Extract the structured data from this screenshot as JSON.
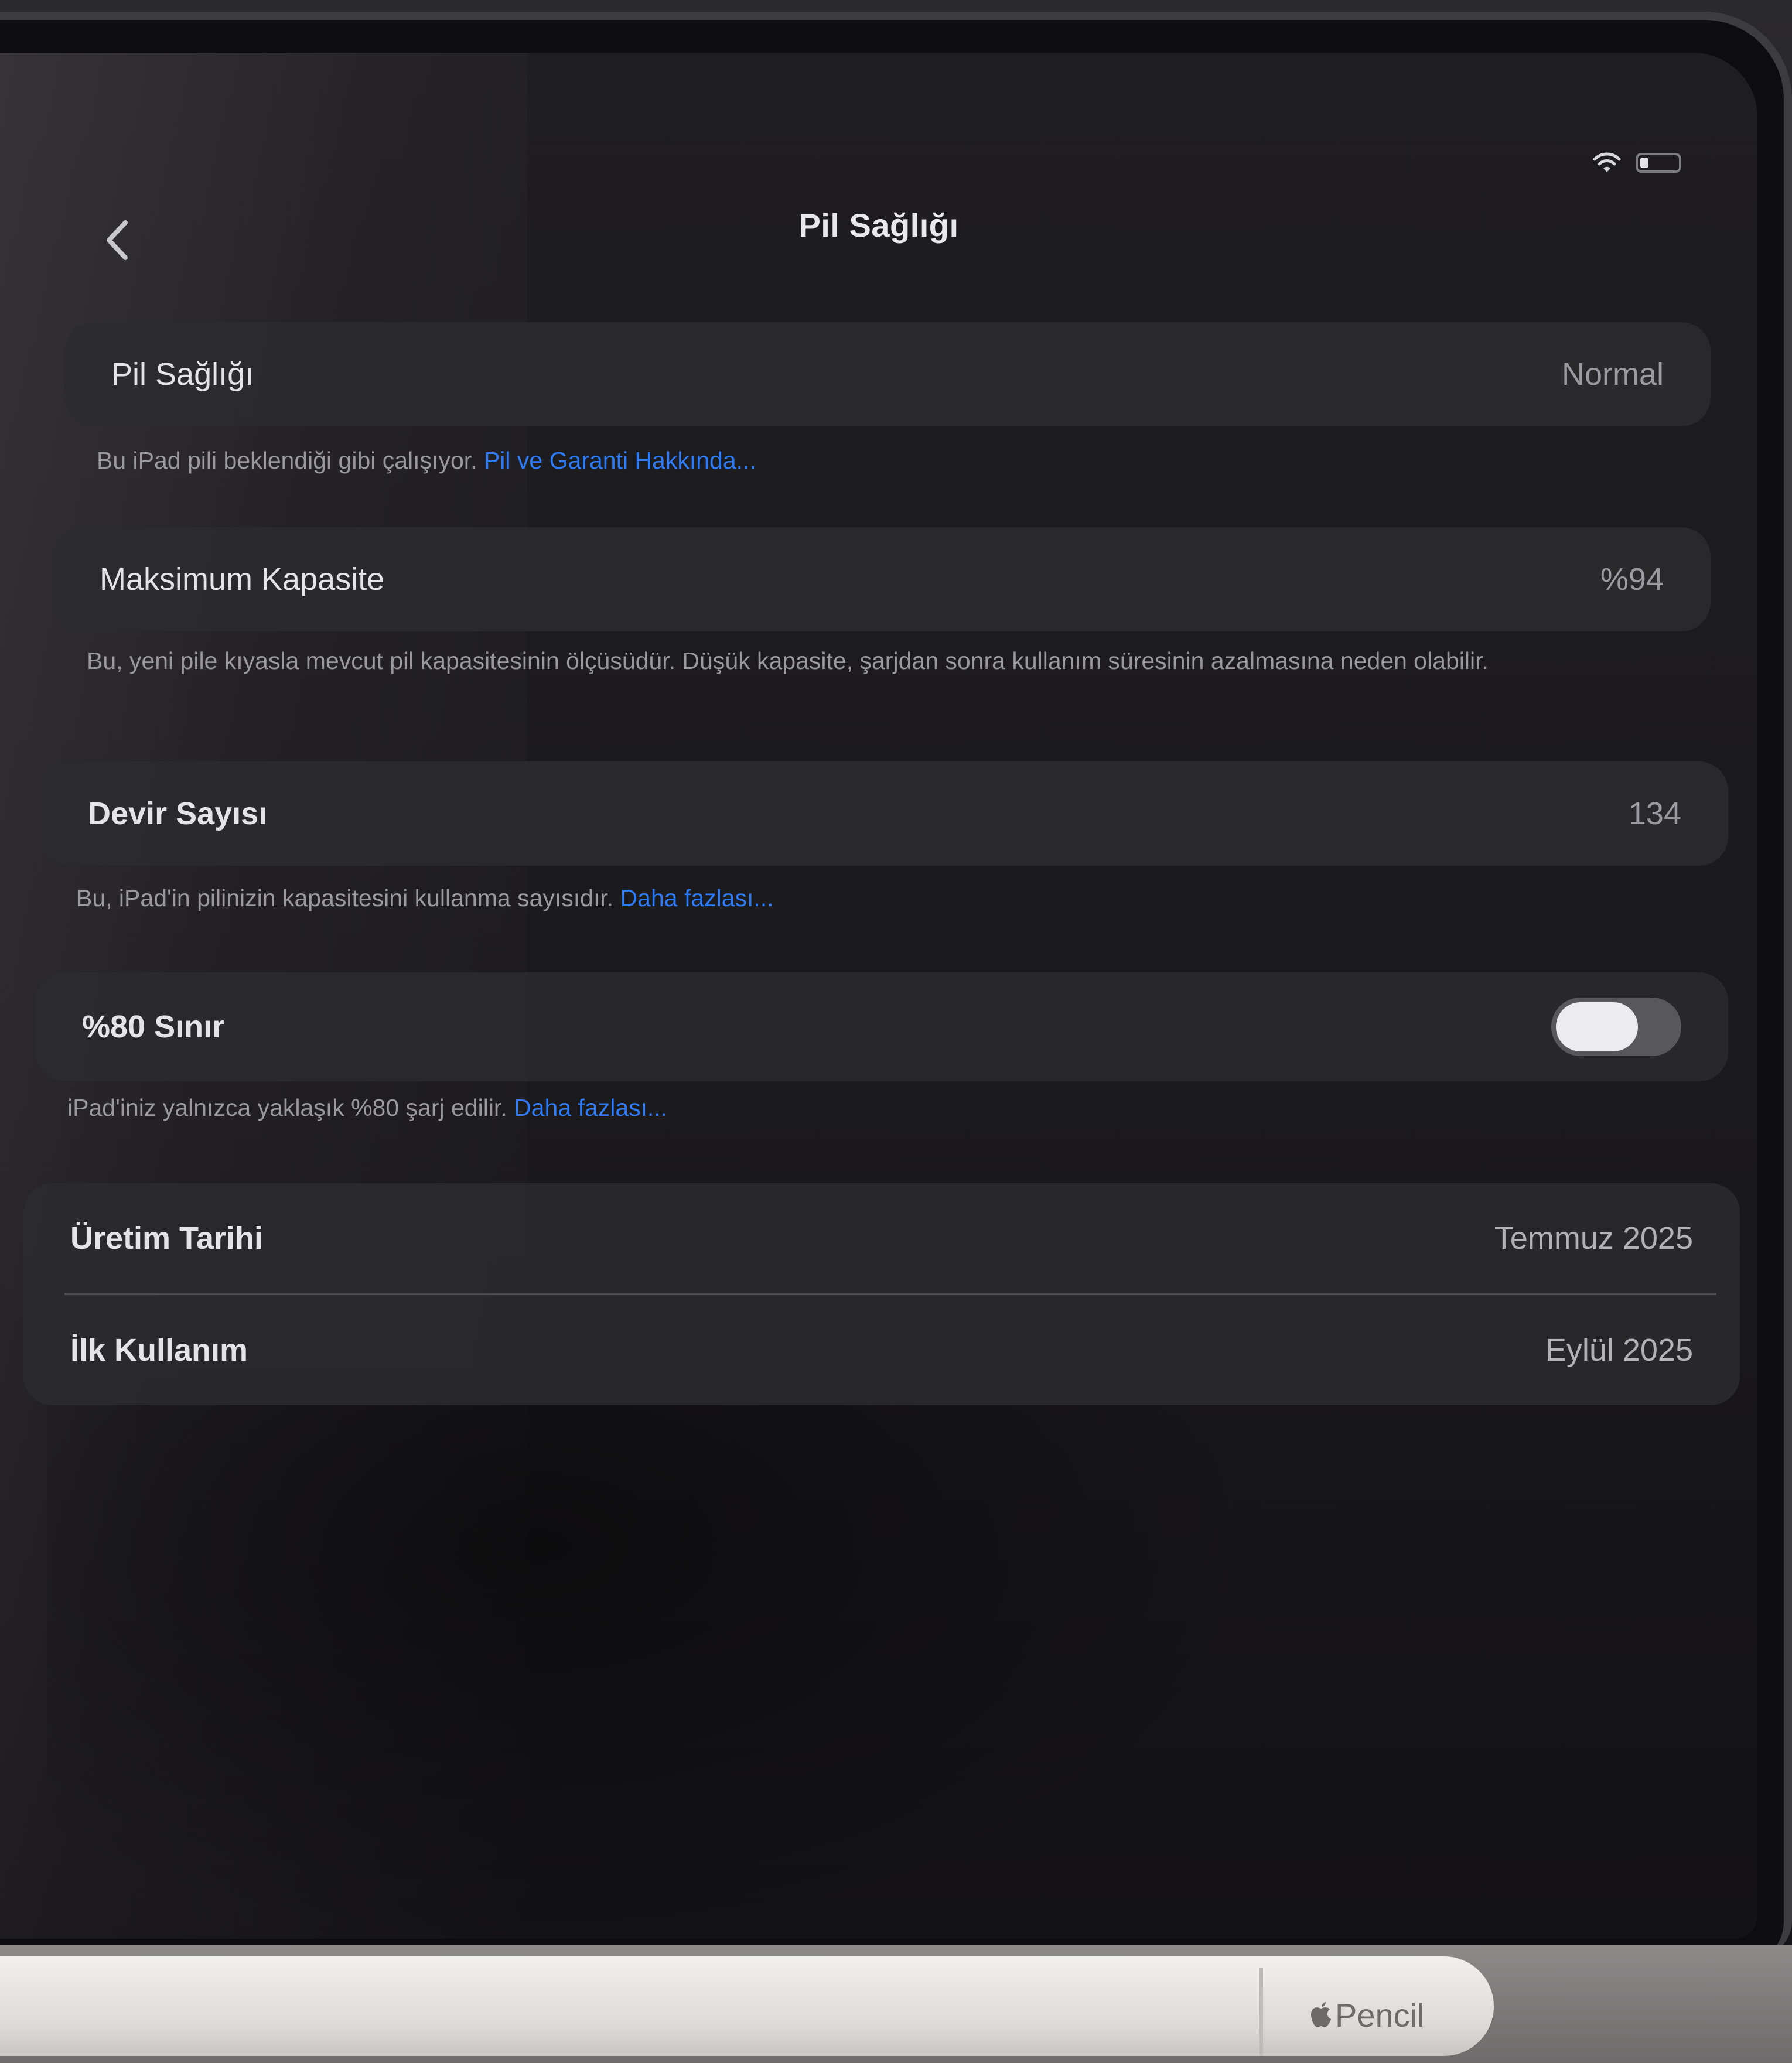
{
  "status": {
    "wifi_icon": "wifi-icon",
    "battery_icon": "battery-icon"
  },
  "nav": {
    "back_icon": "chevron-left-icon",
    "title": "Pil Sağlığı"
  },
  "battery_health": {
    "label": "Pil Sağlığı",
    "value": "Normal",
    "note": "Bu iPad pili beklendiği gibi çalışıyor.",
    "link": "Pil ve Garanti Hakkında..."
  },
  "max_capacity": {
    "label": "Maksimum Kapasite",
    "value": "%94",
    "note": "Bu, yeni pile kıyasla mevcut pil kapasitesinin ölçüsüdür. Düşük kapasite, şarjdan sonra kullanım süresinin azalmasına neden olabilir."
  },
  "cycle_count": {
    "label": "Devir Sayısı",
    "value": "134",
    "note": "Bu, iPad'in pilinizin kapasitesini kullanma sayısıdır.",
    "link": "Daha fazlası..."
  },
  "limit_80": {
    "label": "%80 Sınır",
    "toggle_on": true,
    "note": "iPad'iniz yalnızca yaklaşık %80 şarj edilir.",
    "link": "Daha fazlası..."
  },
  "dates": {
    "manufacture_label": "Üretim Tarihi",
    "manufacture_value": "Temmuz 2025",
    "first_use_label": "İlk Kullanım",
    "first_use_value": "Eylül 2025"
  },
  "accessory": {
    "brand": "Pencil",
    "logo_icon": "apple-logo-icon"
  },
  "colors": {
    "link": "#2f7bf5",
    "background": "#1b1a1c",
    "group": "#2c2b2f"
  }
}
